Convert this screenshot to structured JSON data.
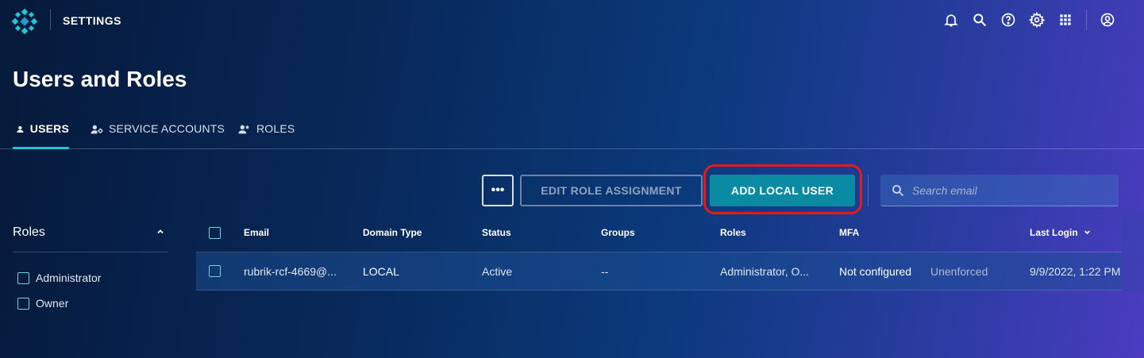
{
  "header": {
    "app_title": "SETTINGS",
    "icons": [
      "logo-icon",
      "bell-icon",
      "search-icon",
      "help-icon",
      "gear-icon",
      "apps-grid-icon",
      "account-icon"
    ]
  },
  "page": {
    "title": "Users and Roles"
  },
  "tabs": [
    {
      "label": "USERS",
      "icon": "user-icon",
      "active": true
    },
    {
      "label": "SERVICE ACCOUNTS",
      "icon": "service-account-icon",
      "active": false
    },
    {
      "label": "ROLES",
      "icon": "roles-icon",
      "active": false
    }
  ],
  "toolbar": {
    "more_label": "•••",
    "edit_role_label": "EDIT ROLE ASSIGNMENT",
    "add_user_label": "ADD LOCAL USER",
    "search_placeholder": "Search email"
  },
  "filters": {
    "title": "Roles",
    "items": [
      {
        "label": "Administrator",
        "checked": false
      },
      {
        "label": "Owner",
        "checked": false
      }
    ]
  },
  "table": {
    "columns": [
      "Email",
      "Domain Type",
      "Status",
      "Groups",
      "Roles",
      "MFA",
      "Last Login"
    ],
    "rows": [
      {
        "email": "rubrik-rcf-4669@...",
        "domain_type": "LOCAL",
        "status": "Active",
        "groups": "--",
        "roles": "Administrator, O...",
        "mfa": "Not configured",
        "mfa_enforcement": "Unenforced",
        "last_login": "9/9/2022, 1:22 PM"
      }
    ]
  },
  "colors": {
    "accent": "#1ec8d8",
    "primary_button": "#0a8aa3",
    "highlight_ring": "#e51a1a"
  }
}
